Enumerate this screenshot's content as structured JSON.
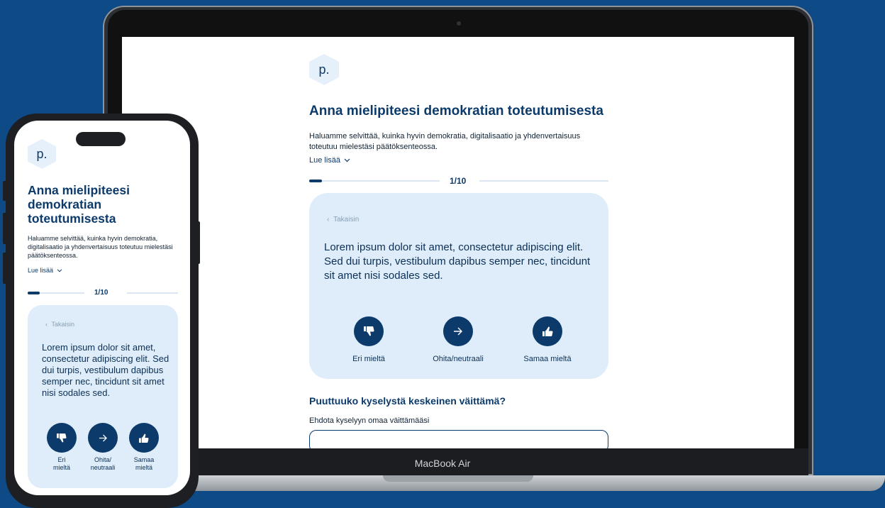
{
  "desktop": {
    "logo_letter": "p.",
    "title": "Anna mielipiteesi demokratian toteutumisesta",
    "description": "Haluamme selvittää, kuinka hyvin demokratia, digitalisaatio ja yhdenvertaisuus toteutuu mielestäsi päätöksenteossa.",
    "read_more": "Lue lisää",
    "progress_label": "1/10",
    "progress_fraction": 0.1,
    "back_label": "Takaisin",
    "statement": "Lorem ipsum dolor sit amet, consectetur adipiscing elit. Sed dui turpis, vestibulum dapibus semper nec, tincidunt sit amet nisi sodales sed.",
    "disagree_label": "Eri mieltä",
    "neutral_label": "Ohita/neutraali",
    "agree_label": "Samaa mieltä",
    "missing_title": "Puuttuuko kyselystä keskeinen väittämä?",
    "suggest_label": "Ehdota kyselyyn omaa väittämääsi"
  },
  "laptop_model": "MacBook Air",
  "mobile": {
    "logo_letter": "p.",
    "title": "Anna mielipiteesi demokratian toteutumisesta",
    "description": "Haluamme selvittää, kuinka hyvin demokratia, digitalisaatio ja yhdenvertaisuus toteutuu mielestäsi päätöksenteossa.",
    "read_more": "Lue lisää",
    "progress_label": "1/10",
    "back_label": "Takaisin",
    "statement": "Lorem ipsum dolor sit amet, consectetur adipiscing elit. Sed dui turpis, vestibulum dapibus semper nec, tincidunt sit amet nisi sodales sed.",
    "disagree_label_1": "Eri",
    "disagree_label_2": "mieltä",
    "neutral_label_1": "Ohita/",
    "neutral_label_2": "neutraali",
    "agree_label_1": "Samaa",
    "agree_label_2": "mieltä"
  },
  "colors": {
    "background": "#0d4a86",
    "primary": "#0b3a6b",
    "card": "#deedf9"
  },
  "icons": {
    "disagree": "thumbs-down-icon",
    "neutral": "arrow-right-icon",
    "agree": "thumbs-up-icon",
    "expand": "chevron-down-icon",
    "back": "chevron-left-icon"
  }
}
